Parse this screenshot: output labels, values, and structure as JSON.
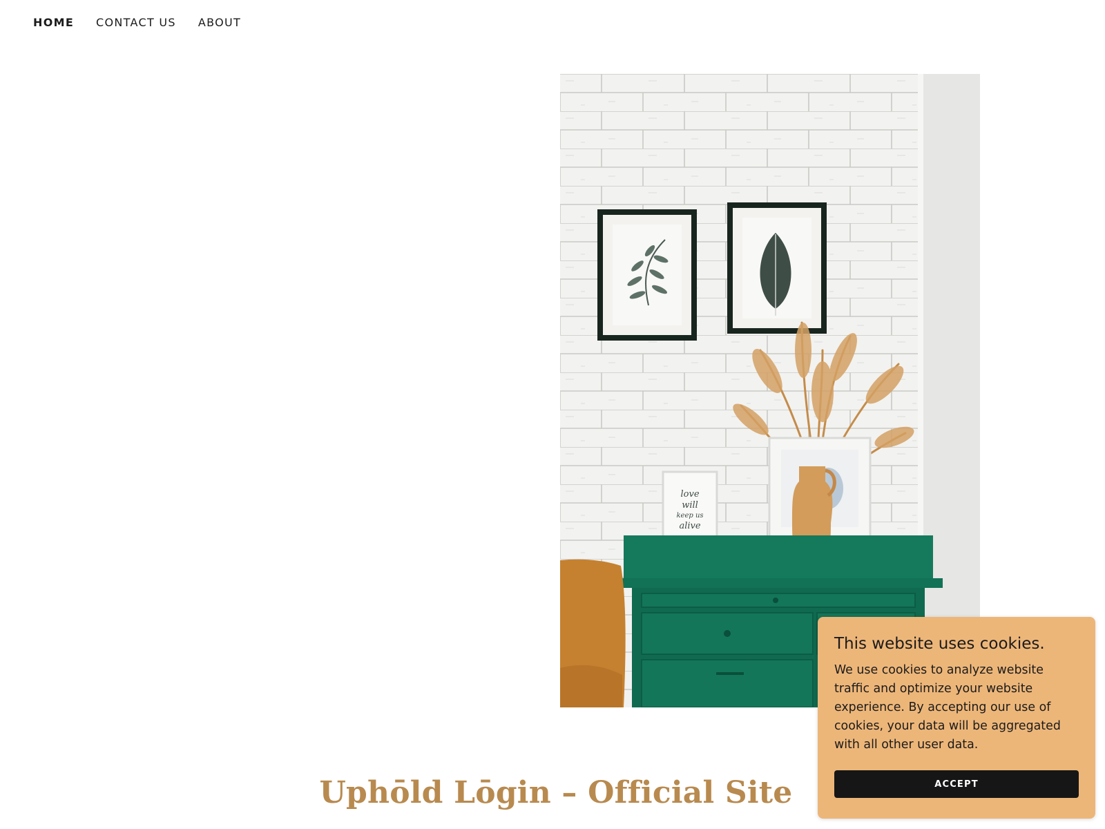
{
  "nav": {
    "items": [
      {
        "label": "HOME",
        "active": true
      },
      {
        "label": "CONTACT US",
        "active": false
      },
      {
        "label": "ABOUT",
        "active": false
      }
    ]
  },
  "hero": {
    "image": "photo-white-brick-wall-framed-leaf-prints-dried-pampas-grass-vase-green-cabinet",
    "frame_text": "love will keep us alive"
  },
  "site_title": "Uphōld Lōgin – Official Site",
  "cookie_banner": {
    "title": "This website uses cookies.",
    "text": "We use cookies to analyze website traffic and optimize your website experience. By accepting our use of cookies, your data will be aggregated with all other user data.",
    "accept_label": "ACCEPT"
  },
  "colors": {
    "title": "#b88a4f",
    "cookie_bg": "#edb679",
    "button_bg": "#161616",
    "cabinet": "#137a5c"
  }
}
